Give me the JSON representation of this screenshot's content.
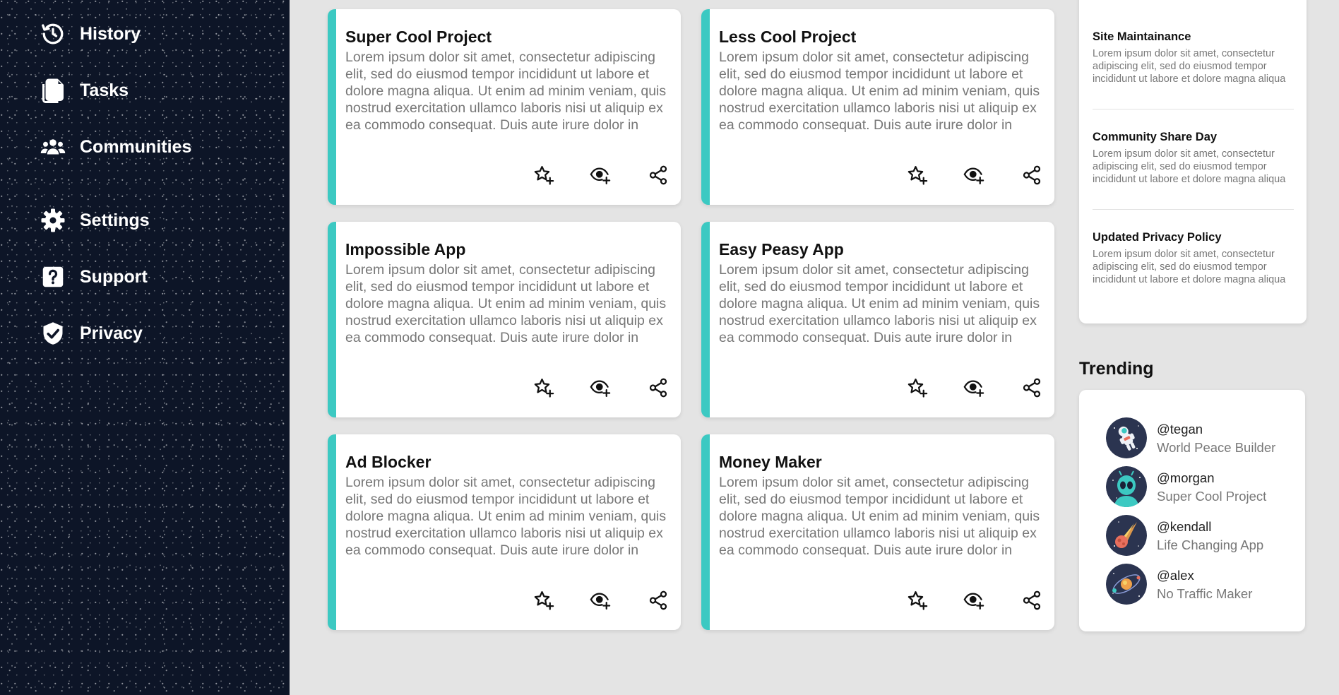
{
  "sidebar": {
    "items": [
      {
        "label": "History",
        "icon": "history-icon"
      },
      {
        "label": "Tasks",
        "icon": "document-icon"
      },
      {
        "label": "Communities",
        "icon": "people-icon"
      },
      {
        "label": "Settings",
        "icon": "gear-icon"
      },
      {
        "label": "Support",
        "icon": "help-icon"
      },
      {
        "label": "Privacy",
        "icon": "shield-check-icon"
      }
    ]
  },
  "colors": {
    "accent": "#3cc9c2",
    "sidebar_bg": "#0d1527",
    "page_bg": "#e4e4e4"
  },
  "projects": [
    {
      "title": "Super Cool Project",
      "description": "Lorem ipsum dolor sit amet, consectetur adipiscing elit, sed do eiusmod tempor incididunt ut labore et dolore magna aliqua. Ut enim ad minim veniam, quis nostrud exercitation ullamco laboris nisi ut aliquip ex ea commodo consequat. Duis aute irure dolor in"
    },
    {
      "title": "Less Cool Project",
      "description": "Lorem ipsum dolor sit amet, consectetur adipiscing elit, sed do eiusmod tempor incididunt ut labore et dolore magna aliqua. Ut enim ad minim veniam, quis nostrud exercitation ullamco laboris nisi ut aliquip ex ea commodo consequat. Duis aute irure dolor in"
    },
    {
      "title": "Impossible App",
      "description": "Lorem ipsum dolor sit amet, consectetur adipiscing elit, sed do eiusmod tempor incididunt ut labore et dolore magna aliqua. Ut enim ad minim veniam, quis nostrud exercitation ullamco laboris nisi ut aliquip ex ea commodo consequat. Duis aute irure dolor in"
    },
    {
      "title": "Easy Peasy App",
      "description": "Lorem ipsum dolor sit amet, consectetur adipiscing elit, sed do eiusmod tempor incididunt ut labore et dolore magna aliqua. Ut enim ad minim veniam, quis nostrud exercitation ullamco laboris nisi ut aliquip ex ea commodo consequat. Duis aute irure dolor in"
    },
    {
      "title": "Ad Blocker",
      "description": "Lorem ipsum dolor sit amet, consectetur adipiscing elit, sed do eiusmod tempor incididunt ut labore et dolore magna aliqua. Ut enim ad minim veniam, quis nostrud exercitation ullamco laboris nisi ut aliquip ex ea commodo consequat. Duis aute irure dolor in"
    },
    {
      "title": "Money Maker",
      "description": "Lorem ipsum dolor sit amet, consectetur adipiscing elit, sed do eiusmod tempor incididunt ut labore et dolore magna aliqua. Ut enim ad minim veniam, quis nostrud exercitation ullamco laboris nisi ut aliquip ex ea commodo consequat. Duis aute irure dolor in"
    }
  ],
  "card_actions": [
    "star-plus-icon",
    "eye-plus-icon",
    "share-icon"
  ],
  "announcements": [
    {
      "title": "Site Maintainance",
      "body": "Lorem ipsum dolor sit amet, consectetur adipiscing elit, sed do eiusmod tempor incididunt ut labore et dolore magna aliqua"
    },
    {
      "title": "Community Share Day",
      "body": "Lorem ipsum dolor sit amet, consectetur adipiscing elit, sed do eiusmod tempor incididunt ut labore et dolore magna aliqua"
    },
    {
      "title": "Updated Privacy Policy",
      "body": "Lorem ipsum dolor sit amet, consectetur adipiscing elit, sed do eiusmod tempor incididunt ut labore et dolore magna aliqua"
    }
  ],
  "trending": {
    "heading": "Trending",
    "users": [
      {
        "handle": "@tegan",
        "project": "World Peace Builder",
        "avatar": "astronaut-avatar"
      },
      {
        "handle": "@morgan",
        "project": "Super Cool Project",
        "avatar": "alien-avatar"
      },
      {
        "handle": "@kendall",
        "project": "Life Changing App",
        "avatar": "comet-avatar"
      },
      {
        "handle": "@alex",
        "project": "No Traffic Maker",
        "avatar": "planet-avatar"
      }
    ]
  }
}
